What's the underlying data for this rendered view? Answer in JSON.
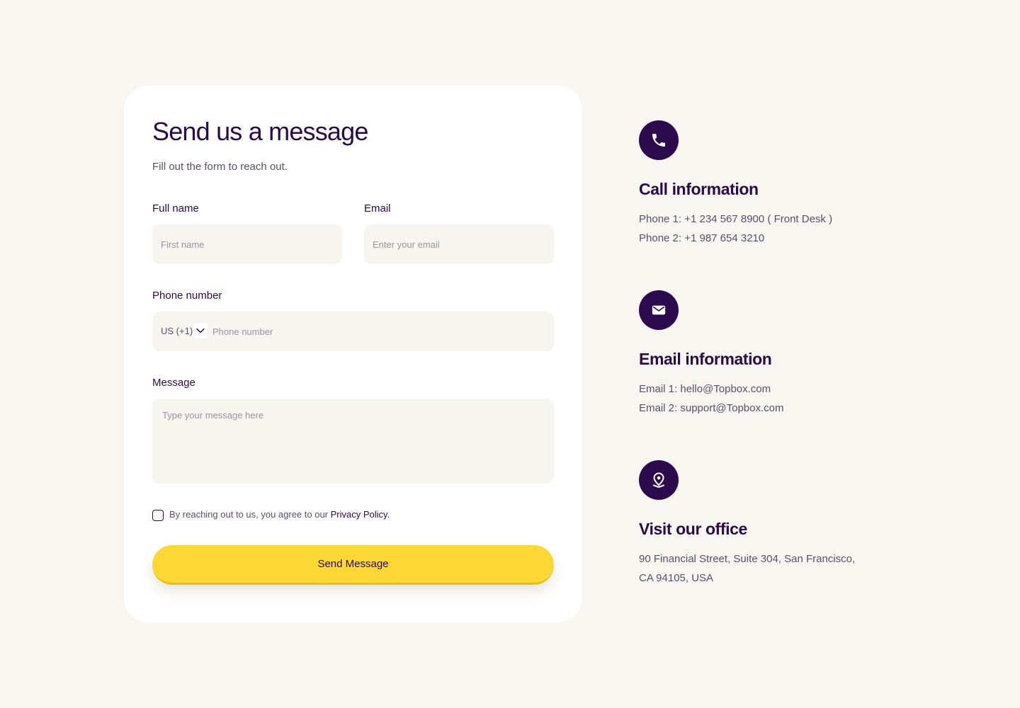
{
  "form": {
    "title": "Send us a message",
    "subtitle": "Fill out the form to reach out.",
    "full_name": {
      "label": "Full name",
      "placeholder": "First name"
    },
    "email": {
      "label": "Email",
      "placeholder": "Enter your email"
    },
    "phone": {
      "label": "Phone number",
      "country_code": "US (+1)",
      "placeholder": "Phone number"
    },
    "message": {
      "label": "Message",
      "placeholder": "Type your message here"
    },
    "consent": {
      "text": "By reaching out to us, you agree to our ",
      "link": "Privacy Policy."
    },
    "submit_label": "Send Message"
  },
  "info": {
    "call": {
      "icon": "phone-icon",
      "title": "Call information",
      "lines": [
        "Phone 1: +1 234 567 8900 ( Front Desk )",
        "Phone 2: +1 987 654 3210"
      ]
    },
    "email": {
      "icon": "envelope-icon",
      "title": "Email information",
      "lines": [
        "Email 1: hello@Topbox.com",
        "Email 2: support@Topbox.com"
      ]
    },
    "office": {
      "icon": "location-pin-icon",
      "title": "Visit our office",
      "lines": [
        "90 Financial Street, Suite 304, San Francisco,",
        "CA 94105, USA"
      ]
    }
  },
  "colors": {
    "background": "#f8f6f1",
    "card": "#ffffff",
    "primary": "#2a0a45",
    "accent": "#fdd835",
    "field": "#f7f5f0"
  }
}
